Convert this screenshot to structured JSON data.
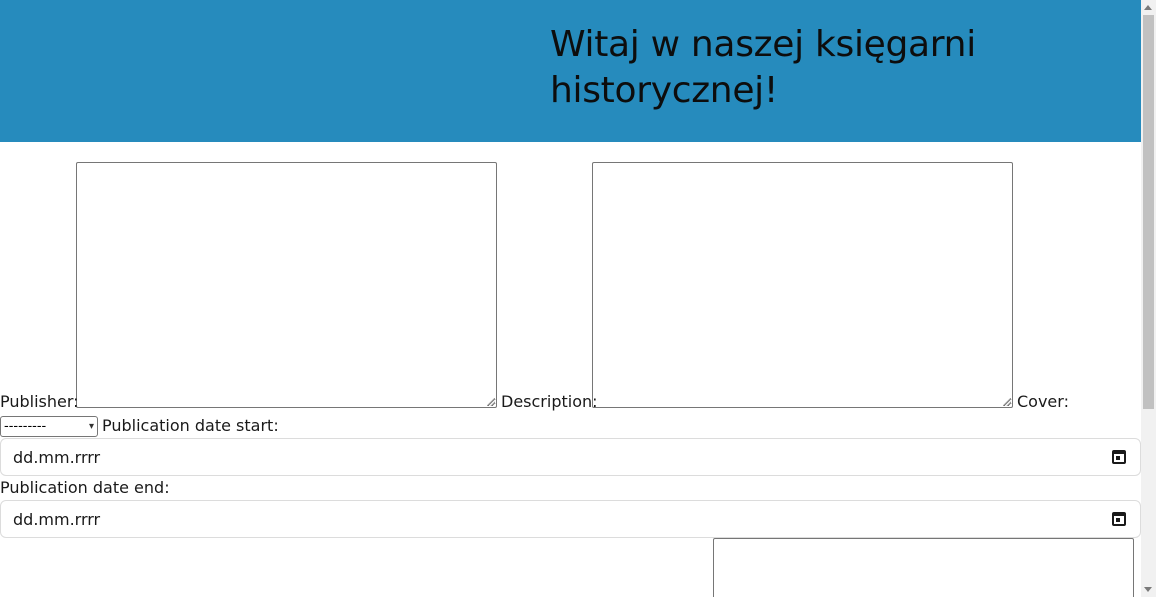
{
  "header": {
    "title": "Witaj w naszej księgarni historycznej!"
  },
  "form": {
    "publisher_label": "Publisher:",
    "description_label": "Description:",
    "cover_label": "Cover:",
    "select_value": "---------",
    "date_start_label": "Publication date start:",
    "date_start_value": "dd.mm.rrrr",
    "date_end_label": "Publication date end:",
    "date_end_value": "dd.mm.rrrr"
  },
  "colors": {
    "header_bg": "#268bbd"
  },
  "icons": {
    "calendar": "calendar-icon",
    "select_caret": "chevron-down-icon"
  }
}
